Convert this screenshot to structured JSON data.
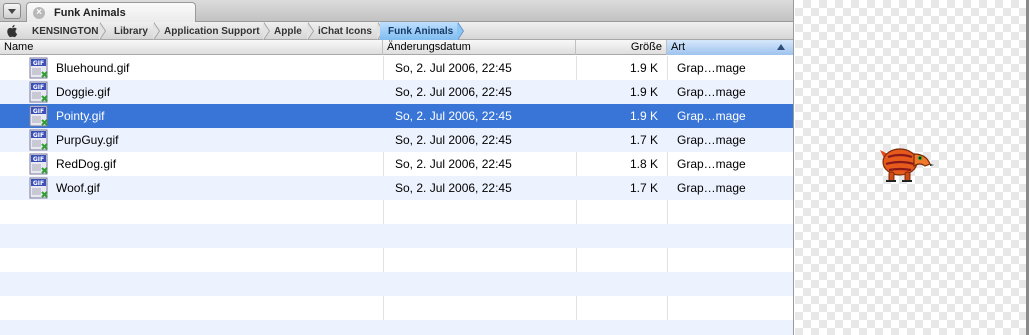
{
  "window": {
    "tab_title": "Funk Animals"
  },
  "path": [
    "KENSINGTON",
    "Library",
    "Application Support",
    "Apple",
    "iChat Icons",
    "Funk Animals"
  ],
  "columns": {
    "name": "Name",
    "date": "Änderungsdatum",
    "size": "Größe",
    "kind": "Art"
  },
  "files": [
    {
      "name": "Bluehound.gif",
      "date": "So, 2. Jul 2006, 22:45",
      "size": "1.9 K",
      "kind": "Grap…mage"
    },
    {
      "name": "Doggie.gif",
      "date": "So, 2. Jul 2006, 22:45",
      "size": "1.9 K",
      "kind": "Grap…mage"
    },
    {
      "name": "Pointy.gif",
      "date": "So, 2. Jul 2006, 22:45",
      "size": "1.9 K",
      "kind": "Grap…mage"
    },
    {
      "name": "PurpGuy.gif",
      "date": "So, 2. Jul 2006, 22:45",
      "size": "1.7 K",
      "kind": "Grap…mage"
    },
    {
      "name": "RedDog.gif",
      "date": "So, 2. Jul 2006, 22:45",
      "size": "1.8 K",
      "kind": "Grap…mage"
    },
    {
      "name": "Woof.gif",
      "date": "So, 2. Jul 2006, 22:45",
      "size": "1.7 K",
      "kind": "Grap…mage"
    }
  ],
  "icon_label": "GIF",
  "selected_index": 2,
  "icons": {
    "tab_menu": "chevron-down-icon",
    "tab_close": "close-icon",
    "root": "apple-icon",
    "file": "gif-file-icon",
    "sort": "sort-ascending-icon"
  },
  "colors": {
    "selection": "#3875d7",
    "alternate_row": "#edf3fe",
    "current_crumb": "#8cc4f2"
  }
}
